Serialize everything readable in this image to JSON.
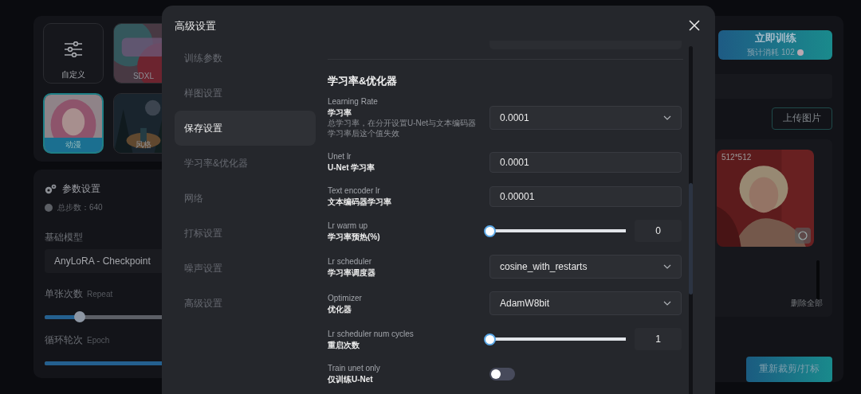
{
  "background": {
    "presets": [
      {
        "label": "自定义",
        "kind": "icon",
        "selected": false
      },
      {
        "label": "SDXL",
        "kind": "picture",
        "selected": false
      },
      {
        "label": "动漫",
        "kind": "picture",
        "selected": true
      },
      {
        "label": "风格",
        "kind": "picture",
        "selected": false
      }
    ],
    "params": {
      "title": "参数设置",
      "total_steps": "总步数：640",
      "base_model_label": "基础模型",
      "base_model": "AnyLoRA - Checkpoint",
      "repeat_label": "单张次数",
      "repeat_hint": "Repeat",
      "repeat": {
        "level": 0.22
      },
      "epoch_label": "循环轮次",
      "epoch_hint": "Epoch",
      "epoch": {
        "level": 1
      }
    },
    "train_button": {
      "label": "立即训练",
      "cost": "预计消耗 102"
    },
    "upload_button": "上传图片",
    "image": {
      "size": "512*512"
    },
    "delete_all": "删除全部",
    "recrop_button": "重新裁剪/打标"
  },
  "dialog": {
    "title": "高级设置",
    "nav": [
      {
        "label": "训练参数",
        "selected": false
      },
      {
        "label": "样图设置",
        "selected": false
      },
      {
        "label": "保存设置",
        "selected": true
      },
      {
        "label": "学习率&优化器",
        "selected": false
      },
      {
        "label": "网络",
        "selected": false
      },
      {
        "label": "打标设置",
        "selected": false
      },
      {
        "label": "噪声设置",
        "selected": false
      },
      {
        "label": "高级设置",
        "selected": false
      }
    ],
    "section": "学习率&优化器",
    "settings": [
      {
        "kind": "select",
        "label": "Learning Rate",
        "sublabel": "学习率",
        "description": "总学习率，在分开设置U-Net与文本编码器学习率后这个值失效",
        "value": "0.0001"
      },
      {
        "kind": "input",
        "label": "Unet lr",
        "sublabel": "U-Net 学习率",
        "value": "0.0001"
      },
      {
        "kind": "input",
        "label": "Text encoder lr",
        "sublabel": "文本编码器学习率",
        "value": "0.00001"
      },
      {
        "kind": "slider",
        "label": "Lr warm up",
        "sublabel": "学习率预热(%)",
        "level": 0,
        "value": "0"
      },
      {
        "kind": "select",
        "label": "Lr scheduler",
        "sublabel": "学习率调度器",
        "value": "cosine_with_restarts"
      },
      {
        "kind": "select",
        "label": "Optimizer",
        "sublabel": "优化器",
        "value": "AdamW8bit"
      },
      {
        "kind": "slider",
        "label": "Lr scheduler num cycles",
        "sublabel": "重启次数",
        "level": 0,
        "value": "1"
      },
      {
        "kind": "toggle",
        "label": "Train unet only",
        "sublabel": "仅训练U-Net",
        "on": false
      }
    ]
  }
}
